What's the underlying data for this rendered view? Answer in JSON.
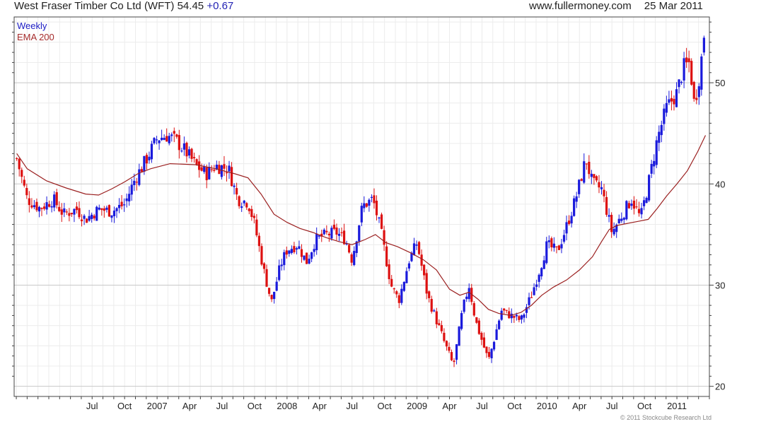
{
  "header": {
    "title": "West Fraser Timber Co Ltd (WFT)",
    "price": "54.45",
    "change": "+0.67",
    "site": "www.fullermoney.com",
    "date": "25 Mar 2011"
  },
  "legend": {
    "weekly": "Weekly",
    "ema": "EMA 200"
  },
  "footer": "© 2011 Stockcube Research Ltd",
  "colors": {
    "up": "#1a1adc",
    "down": "#dd1111",
    "ema": "#9b2020",
    "grid": "#dcdcdc",
    "border": "#444444"
  },
  "chart_data": {
    "type": "candlestick",
    "title": "West Fraser Timber Co Ltd (WFT)",
    "ylim": [
      19,
      56.5
    ],
    "y_ticks": [
      20,
      30,
      40,
      50
    ],
    "x_range": [
      2005.9,
      2011.25
    ],
    "x_tick_labels": [
      {
        "label": "Jul",
        "t": 2006.5
      },
      {
        "label": "Oct",
        "t": 2006.75
      },
      {
        "label": "2007",
        "t": 2007.0
      },
      {
        "label": "Apr",
        "t": 2007.25
      },
      {
        "label": "Jul",
        "t": 2007.5
      },
      {
        "label": "Oct",
        "t": 2007.75
      },
      {
        "label": "2008",
        "t": 2008.0
      },
      {
        "label": "Apr",
        "t": 2008.25
      },
      {
        "label": "Jul",
        "t": 2008.5
      },
      {
        "label": "Oct",
        "t": 2008.75
      },
      {
        "label": "2009",
        "t": 2009.0
      },
      {
        "label": "Apr",
        "t": 2009.25
      },
      {
        "label": "Jul",
        "t": 2009.5
      },
      {
        "label": "Oct",
        "t": 2009.75
      },
      {
        "label": "2010",
        "t": 2010.0
      },
      {
        "label": "Apr",
        "t": 2010.25
      },
      {
        "label": "Jul",
        "t": 2010.5
      },
      {
        "label": "Oct",
        "t": 2010.75
      },
      {
        "label": "2011",
        "t": 2011.0
      }
    ],
    "close_path": [
      [
        2005.92,
        42.5
      ],
      [
        2006.0,
        38.5
      ],
      [
        2006.1,
        37.6
      ],
      [
        2006.2,
        38.5
      ],
      [
        2006.28,
        37.0
      ],
      [
        2006.38,
        37.5
      ],
      [
        2006.45,
        36.5
      ],
      [
        2006.55,
        37.5
      ],
      [
        2006.65,
        37.3
      ],
      [
        2006.75,
        38.0
      ],
      [
        2006.83,
        40.5
      ],
      [
        2006.92,
        42.5
      ],
      [
        2007.0,
        44.5
      ],
      [
        2007.08,
        44.8
      ],
      [
        2007.15,
        44.2
      ],
      [
        2007.22,
        43.2
      ],
      [
        2007.3,
        41.8
      ],
      [
        2007.38,
        41.0
      ],
      [
        2007.45,
        41.8
      ],
      [
        2007.55,
        41.5
      ],
      [
        2007.62,
        38.5
      ],
      [
        2007.7,
        38.2
      ],
      [
        2007.75,
        36.0
      ],
      [
        2007.82,
        31.5
      ],
      [
        2007.88,
        28.3
      ],
      [
        2007.95,
        32.0
      ],
      [
        2008.0,
        33.5
      ],
      [
        2008.08,
        34.0
      ],
      [
        2008.15,
        32.3
      ],
      [
        2008.22,
        34.5
      ],
      [
        2008.3,
        35.0
      ],
      [
        2008.38,
        35.2
      ],
      [
        2008.45,
        34.5
      ],
      [
        2008.5,
        32.5
      ],
      [
        2008.58,
        37.8
      ],
      [
        2008.66,
        38.5
      ],
      [
        2008.72,
        35.5
      ],
      [
        2008.8,
        30.0
      ],
      [
        2008.86,
        28.5
      ],
      [
        2008.94,
        32.5
      ],
      [
        2009.0,
        34.2
      ],
      [
        2009.08,
        29.0
      ],
      [
        2009.15,
        26.5
      ],
      [
        2009.22,
        24.0
      ],
      [
        2009.28,
        22.0
      ],
      [
        2009.35,
        27.5
      ],
      [
        2009.4,
        30.0
      ],
      [
        2009.45,
        26.5
      ],
      [
        2009.5,
        24.5
      ],
      [
        2009.55,
        22.5
      ],
      [
        2009.6,
        25.0
      ],
      [
        2009.65,
        27.5
      ],
      [
        2009.72,
        27.0
      ],
      [
        2009.8,
        26.5
      ],
      [
        2009.88,
        29.0
      ],
      [
        2009.95,
        31.8
      ],
      [
        2010.0,
        34.0
      ],
      [
        2010.08,
        33.3
      ],
      [
        2010.15,
        35.8
      ],
      [
        2010.22,
        38.5
      ],
      [
        2010.3,
        42.5
      ],
      [
        2010.35,
        40.0
      ],
      [
        2010.42,
        39.5
      ],
      [
        2010.5,
        35.2
      ],
      [
        2010.58,
        37.0
      ],
      [
        2010.65,
        38.5
      ],
      [
        2010.72,
        36.6
      ],
      [
        2010.78,
        40.0
      ],
      [
        2010.85,
        44.5
      ],
      [
        2010.92,
        47.5
      ],
      [
        2011.0,
        49.0
      ],
      [
        2011.05,
        51.5
      ],
      [
        2011.1,
        52.0
      ],
      [
        2011.13,
        48.0
      ],
      [
        2011.16,
        49.5
      ],
      [
        2011.19,
        52.5
      ],
      [
        2011.22,
        54.45
      ]
    ],
    "ema200": [
      [
        2005.92,
        43.0
      ],
      [
        2006.0,
        41.5
      ],
      [
        2006.15,
        40.3
      ],
      [
        2006.3,
        39.6
      ],
      [
        2006.45,
        39.0
      ],
      [
        2006.55,
        38.9
      ],
      [
        2006.65,
        39.5
      ],
      [
        2006.75,
        40.2
      ],
      [
        2006.85,
        41.0
      ],
      [
        2006.95,
        41.5
      ],
      [
        2007.1,
        42.0
      ],
      [
        2007.3,
        41.9
      ],
      [
        2007.45,
        41.5
      ],
      [
        2007.6,
        41.0
      ],
      [
        2007.7,
        40.6
      ],
      [
        2007.8,
        39.0
      ],
      [
        2007.9,
        37.0
      ],
      [
        2008.0,
        36.2
      ],
      [
        2008.1,
        35.6
      ],
      [
        2008.2,
        35.2
      ],
      [
        2008.3,
        34.7
      ],
      [
        2008.4,
        34.3
      ],
      [
        2008.5,
        34.0
      ],
      [
        2008.6,
        34.5
      ],
      [
        2008.68,
        35.0
      ],
      [
        2008.76,
        34.2
      ],
      [
        2008.85,
        33.8
      ],
      [
        2008.95,
        33.2
      ],
      [
        2009.05,
        32.5
      ],
      [
        2009.15,
        31.5
      ],
      [
        2009.25,
        29.6
      ],
      [
        2009.33,
        29.0
      ],
      [
        2009.4,
        29.3
      ],
      [
        2009.47,
        28.6
      ],
      [
        2009.55,
        27.6
      ],
      [
        2009.63,
        27.2
      ],
      [
        2009.72,
        27.0
      ],
      [
        2009.8,
        27.3
      ],
      [
        2009.88,
        28.0
      ],
      [
        2009.96,
        29.0
      ],
      [
        2010.05,
        29.8
      ],
      [
        2010.15,
        30.5
      ],
      [
        2010.25,
        31.5
      ],
      [
        2010.35,
        32.8
      ],
      [
        2010.42,
        34.3
      ],
      [
        2010.48,
        35.5
      ],
      [
        2010.54,
        35.9
      ],
      [
        2010.62,
        36.1
      ],
      [
        2010.7,
        36.3
      ],
      [
        2010.78,
        36.5
      ],
      [
        2010.85,
        37.6
      ],
      [
        2010.92,
        38.8
      ],
      [
        2011.0,
        40.0
      ],
      [
        2011.08,
        41.3
      ],
      [
        2011.16,
        43.2
      ],
      [
        2011.22,
        44.8
      ]
    ]
  }
}
